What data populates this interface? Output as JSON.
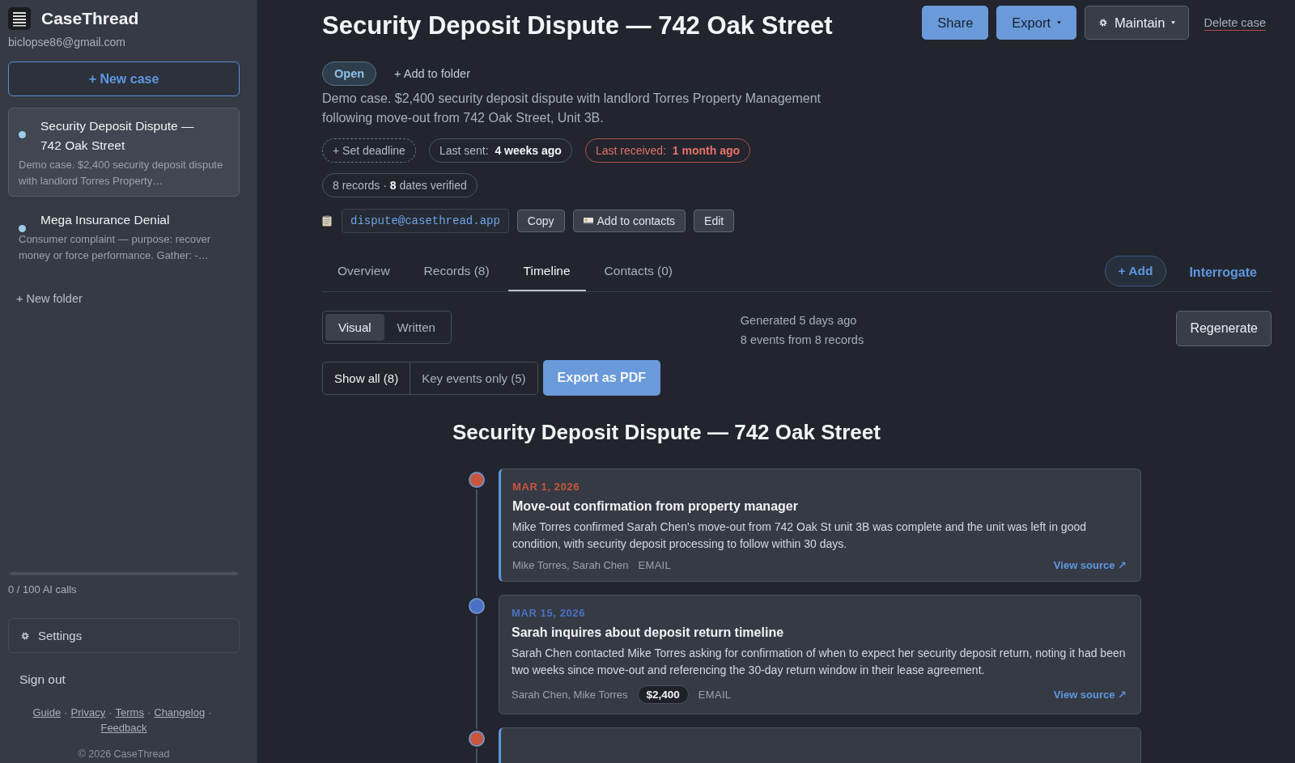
{
  "sidebar": {
    "app_name": "CaseThread",
    "account": "biclopse86@gmail.com",
    "new_case": "+ New case",
    "cases": [
      {
        "title": "Security Deposit Dispute — 742 Oak Street",
        "snippet": "Demo case. $2,400 security deposit dispute with landlord Torres Property…",
        "selected": true
      },
      {
        "title": "Mega Insurance Denial",
        "snippet": "Consumer complaint — purpose: recover money or force performance. Gather: -…",
        "selected": false
      }
    ],
    "new_folder": "+ New folder",
    "usage": {
      "level": 0,
      "reading": "0 / 100 AI calls"
    },
    "settings": "Settings",
    "sign_out": "Sign out",
    "footer_links": [
      {
        "label": "Guide",
        "separator": "·"
      },
      {
        "label": "Privacy",
        "separator": "·"
      },
      {
        "label": "Terms",
        "separator": "·"
      },
      {
        "label": "Changelog",
        "separator": "·"
      },
      {
        "label": "Feedback"
      }
    ],
    "copyright": "© 2026 CaseThread"
  },
  "case": {
    "title": "Security Deposit Dispute — 742 Oak Street",
    "actions": [
      {
        "label": "Share",
        "kind": "primary",
        "menu": false
      },
      {
        "label": "Export",
        "kind": "primary",
        "menu": true
      },
      {
        "label": "Maintain",
        "kind": "gear",
        "menu": true
      },
      {
        "label": "Delete case",
        "kind": "danger-link",
        "menu": false
      }
    ],
    "status": "Open",
    "add_to_folder": "+ Add to folder",
    "description": "Demo case. $2,400 security deposit dispute with landlord Torres Property Management following move-out from 742 Oak Street, Unit 3B.",
    "chips": [
      {
        "kind": "dashed",
        "label": "+ Set deadline"
      },
      {
        "kind": "info",
        "label": "Last sent:",
        "value": "4 weeks ago"
      },
      {
        "kind": "alert",
        "label": "Last received:",
        "value": "1 month ago"
      }
    ],
    "records_summary": "8 records · **8** dates verified",
    "email": "dispute@casethread.app",
    "email_actions": [
      {
        "label": "Copy",
        "icon": false
      },
      {
        "label": "Add to contacts",
        "icon": true
      },
      {
        "label": "Edit",
        "icon": false
      }
    ]
  },
  "tabs": [
    {
      "label": "Overview",
      "selected": false
    },
    {
      "label": "Records (8)",
      "selected": false
    },
    {
      "label": "Timeline",
      "selected": true
    },
    {
      "label": "Contacts (0)",
      "selected": false
    }
  ],
  "tab_actions": {
    "add": "+ Add",
    "interrogate": "Interrogate"
  },
  "view_toggle": [
    {
      "label": "Visual",
      "selected": true
    },
    {
      "label": "Written",
      "selected": false
    }
  ],
  "generated": [
    "Generated 5 days ago",
    "8 events from 8 records"
  ],
  "regenerate": "Regenerate",
  "filters": [
    {
      "label": "Show all (8)",
      "selected": true
    },
    {
      "label": "Key events only (5)",
      "selected": false
    }
  ],
  "export_pdf": "Export as PDF",
  "timeline": {
    "title": "Security Deposit Dispute — 742 Oak Street",
    "events": [
      {
        "date": "MAR 1, 2026",
        "color": "#c8553d",
        "key": true,
        "title": "Move-out confirmation from property manager",
        "body": "Mike Torres confirmed Sarah Chen's move-out from 742 Oak St unit 3B was complete and the unit was left in good condition, with security deposit processing to follow within 30 days.",
        "people": "Mike Torres, Sarah Chen",
        "type": "EMAIL",
        "link": "View source ↗"
      },
      {
        "date": "MAR 15, 2026",
        "color": "#4a72c4",
        "key": false,
        "title": "Sarah inquires about deposit return timeline",
        "body": "Sarah Chen contacted Mike Torres asking for confirmation of when to expect her security deposit return, noting it had been two weeks since move-out and referencing the 30-day return window in their lease agreement.",
        "people": "Sarah Chen, Mike Torres",
        "amount": "$2,400",
        "type": "EMAIL",
        "link": "View source ↗"
      },
      {
        "color": "#c8553d",
        "key": true
      }
    ]
  }
}
